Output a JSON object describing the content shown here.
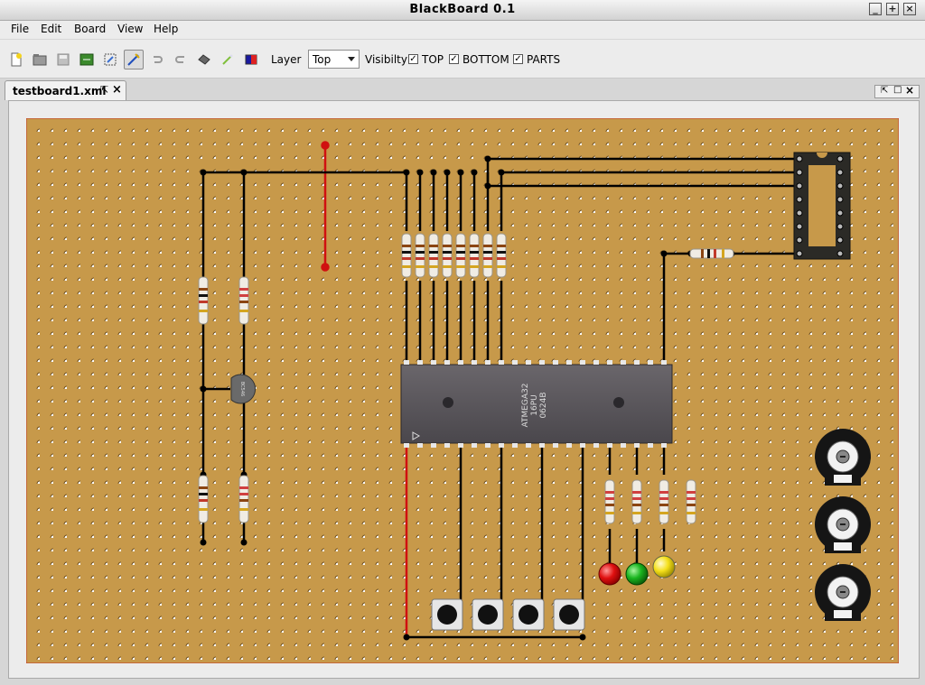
{
  "window": {
    "title": "BlackBoard 0.1"
  },
  "menu": [
    "File",
    "Edit",
    "Board",
    "View",
    "Help"
  ],
  "toolbar": {
    "layer_label": "Layer",
    "layer_value": "Top",
    "visibility_label": "Visibilty",
    "checks": [
      {
        "label": "TOP",
        "checked": true
      },
      {
        "label": "BOTTOM",
        "checked": true
      },
      {
        "label": "PARTS",
        "checked": true
      }
    ]
  },
  "tab": {
    "label": "testboard1.xml"
  },
  "chip": {
    "line1": "ATMEGA32",
    "line2": "16PU",
    "line3": "0624B"
  },
  "transistor": {
    "label": "BC546"
  },
  "colors": {
    "board": "#c7994a",
    "wire": "#000000",
    "power_wire": "#d01010",
    "led_red": "#e01010",
    "led_green": "#19b51f",
    "led_yellow": "#f4e01a"
  }
}
